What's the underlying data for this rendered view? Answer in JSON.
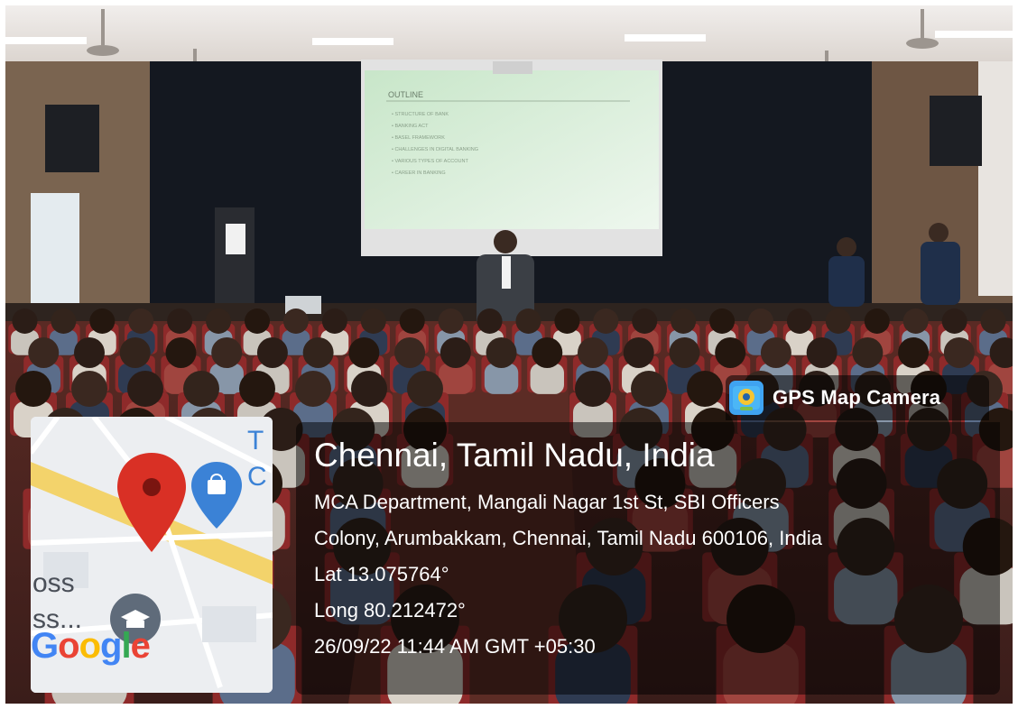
{
  "stamp": {
    "app_name": "GPS Map Camera",
    "city": "Chennai, Tamil Nadu, India",
    "address_line1": "MCA Department, Mangali Nagar 1st St, SBI Officers",
    "address_line2": "Colony, Arumbakkam, Chennai, Tamil Nadu 600106, India",
    "lat": "Lat 13.075764°",
    "long": "Long 80.212472°",
    "datetime": "26/09/22 11:44 AM GMT +05:30"
  },
  "slide": {
    "heading": "OUTLINE",
    "bullets": [
      "STRUCTURE OF BANK",
      "BANKING ACT",
      "BASEL FRAMEWORK",
      "CHALLENGES IN DIGITAL BANKING",
      "VARIOUS TYPES OF ACCOUNT",
      "CAREER IN BANKING"
    ]
  },
  "map": {
    "label_top_1": "T",
    "label_top_2": "C",
    "label_left_1": "oss",
    "label_left_2": "ss...",
    "logo": [
      "G",
      "o",
      "o",
      "g",
      "l",
      "e"
    ],
    "logo_colors": [
      "#4285F4",
      "#EA4335",
      "#FBBC05",
      "#4285F4",
      "#34A853",
      "#EA4335"
    ],
    "pin_color": "#D93025",
    "shop_pin_color": "#3B82D6",
    "road_color": "#F3D36B"
  },
  "colors": {
    "slide_bg": "#D8EED8",
    "seat_red": "#8E2A2A",
    "stage_curtain": "#141820"
  }
}
